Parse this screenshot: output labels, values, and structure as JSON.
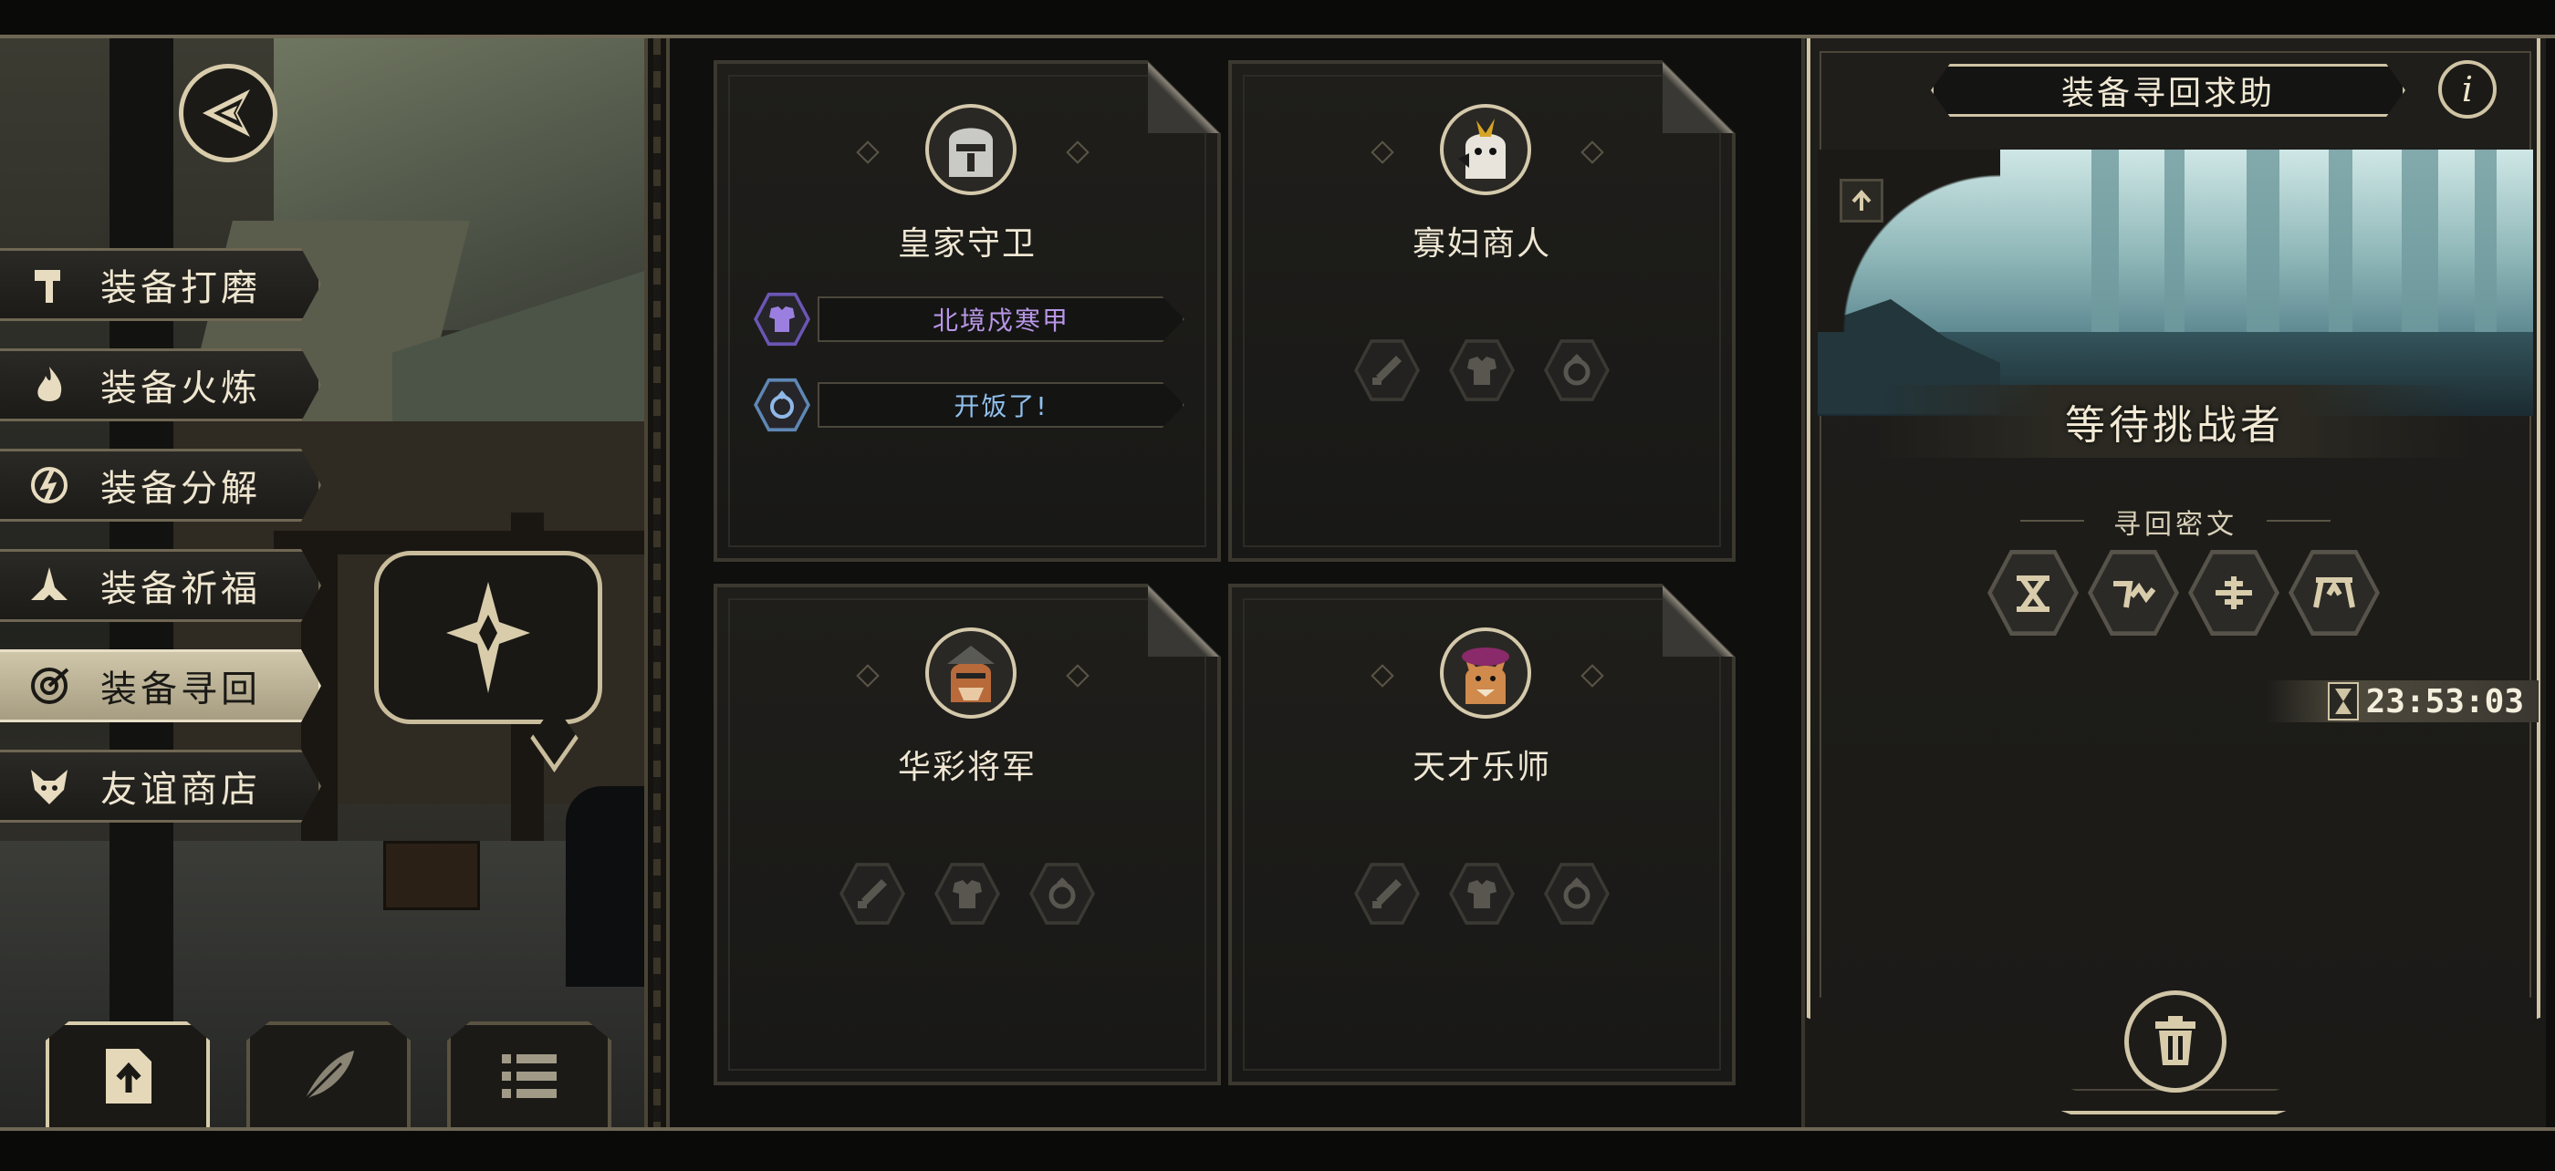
{
  "sidebar": {
    "items": [
      {
        "label": "装备打磨",
        "icon": "hammer-icon",
        "active": false
      },
      {
        "label": "装备火炼",
        "icon": "flame-icon",
        "active": false
      },
      {
        "label": "装备分解",
        "icon": "disassemble-icon",
        "active": false
      },
      {
        "label": "装备祈福",
        "icon": "praying-hands-icon",
        "active": false
      },
      {
        "label": "装备寻回",
        "icon": "target-icon",
        "active": true
      },
      {
        "label": "友谊商店",
        "icon": "fox-icon",
        "active": false
      }
    ]
  },
  "bottom_nav": [
    {
      "icon": "upload-file-icon",
      "active": true
    },
    {
      "icon": "feather-icon",
      "active": false
    },
    {
      "icon": "list-icon",
      "active": false
    }
  ],
  "cards": [
    {
      "name": "皇家守卫",
      "avatar": "knight-avatar",
      "equipment": [
        {
          "label": "北境戍寒甲",
          "icon": "armor-icon",
          "color": "#b796e6",
          "icon_color": "#6b56b4"
        },
        {
          "label": "开饭了!",
          "icon": "ring-icon",
          "color": "#8fc0ee",
          "icon_color": "#5f87b4"
        }
      ]
    },
    {
      "name": "寡妇商人",
      "avatar": "merchant-avatar",
      "slots": [
        "sword-slot-icon",
        "armor-slot-icon",
        "ring-slot-icon"
      ]
    },
    {
      "name": "华彩将军",
      "avatar": "general-avatar",
      "slots": [
        "sword-slot-icon",
        "armor-slot-icon",
        "ring-slot-icon"
      ]
    },
    {
      "name": "天才乐师",
      "avatar": "musician-avatar",
      "slots": [
        "sword-slot-icon",
        "armor-slot-icon",
        "ring-slot-icon"
      ]
    }
  ],
  "right_panel": {
    "title": "装备寻回求助",
    "status": "等待挑战者",
    "cipher_label": "寻回密文",
    "ciphers": [
      "cipher-rune-1-icon",
      "cipher-rune-2-icon",
      "cipher-rune-3-icon",
      "cipher-rune-4-icon"
    ],
    "timer": "23:53:03"
  },
  "colors": {
    "accent": "#d0c5a6",
    "active_menu": "#cfc6aa",
    "epic_purple": "#b796e6",
    "rare_blue": "#8fc0ee"
  }
}
